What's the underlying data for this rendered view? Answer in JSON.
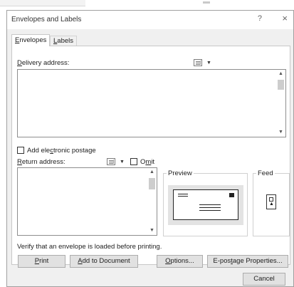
{
  "dialog": {
    "title": "Envelopes and Labels",
    "help": "?",
    "close": "×"
  },
  "tabs": {
    "envelopes": {
      "key": "E",
      "rest": "nvelopes"
    },
    "labels": {
      "key": "L",
      "rest": "abels"
    }
  },
  "delivery": {
    "label_key": "D",
    "label_rest": "elivery address:",
    "value": ""
  },
  "postage": {
    "pre": "Add ele",
    "key": "c",
    "post": "tronic postage",
    "checked": false
  },
  "return": {
    "label_key": "R",
    "label_rest": "eturn address:",
    "value": "",
    "omit_pre": "O",
    "omit_key": "m",
    "omit_post": "it",
    "omit_checked": false
  },
  "preview": {
    "title": "Preview"
  },
  "feed": {
    "title": "Feed"
  },
  "verify_text": "Verify that an envelope is loaded before printing.",
  "buttons": {
    "print": {
      "key": "P",
      "rest": "rint"
    },
    "add_doc": {
      "key": "A",
      "rest": "dd to Document"
    },
    "options": {
      "key": "O",
      "rest": "ptions..."
    },
    "epostage": {
      "pre": "E-pos",
      "key": "t",
      "post": "age Properties..."
    },
    "cancel": "Cancel"
  },
  "icons": {
    "address_book": "address-book-icon",
    "dropdown": "chevron-down-icon",
    "scroll_up": "scroll-up-icon",
    "scroll_down": "scroll-down-icon",
    "envelope": "envelope-icon",
    "feed": "feed-icon"
  }
}
